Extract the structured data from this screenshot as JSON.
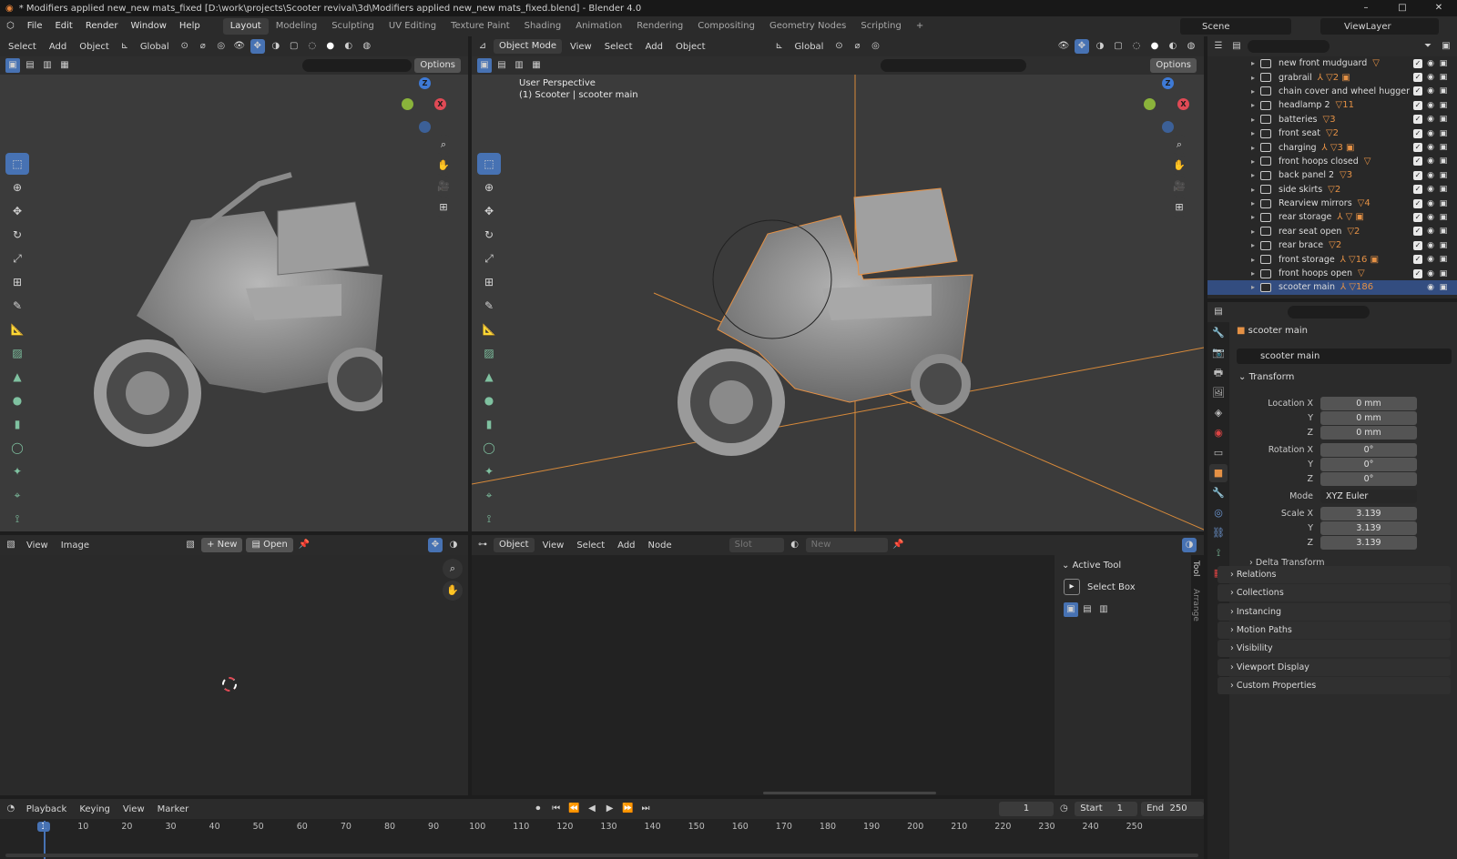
{
  "window": {
    "title": "* Modifiers applied new_new mats_fixed [D:\\work\\projects\\Scooter revival\\3d\\Modifiers applied new_new mats_fixed.blend] - Blender 4.0",
    "min": "–",
    "max": "□",
    "close": "✕"
  },
  "menu": [
    "File",
    "Edit",
    "Render",
    "Window",
    "Help"
  ],
  "workspaces": [
    "Layout",
    "Modeling",
    "Sculpting",
    "UV Editing",
    "Texture Paint",
    "Shading",
    "Animation",
    "Rendering",
    "Compositing",
    "Geometry Nodes",
    "Scripting",
    "+"
  ],
  "scene": {
    "label": "Scene",
    "viewlayer": "ViewLayer"
  },
  "vp_left": {
    "menus": [
      "Select",
      "Add",
      "Object"
    ],
    "orientation": "Global",
    "options": "Options"
  },
  "vp_right": {
    "mode": "Object Mode",
    "menus": [
      "View",
      "Select",
      "Add",
      "Object"
    ],
    "orientation": "Global",
    "options": "Options",
    "overlay_title": "User Perspective",
    "overlay_sub": "(1) Scooter | scooter main"
  },
  "image_editor": {
    "menus": [
      "View",
      "Image"
    ],
    "new": "New",
    "open": "Open"
  },
  "node_editor": {
    "type": "Object",
    "menus": [
      "View",
      "Select",
      "Add",
      "Node"
    ],
    "slot": "Slot",
    "new": "New",
    "side_tabs": [
      "Tool",
      "Arrange"
    ],
    "active_tool_title": "Active Tool",
    "active_tool": "Select Box"
  },
  "outliner": {
    "items": [
      {
        "name": "new front mudguard",
        "icons": "▽"
      },
      {
        "name": "grabrail",
        "icons": "⅄ ▽2 ▣"
      },
      {
        "name": "chain cover and wheel hugger",
        "icons": ""
      },
      {
        "name": "headlamp 2",
        "icons": "▽11"
      },
      {
        "name": "batteries",
        "icons": "▽3"
      },
      {
        "name": "front seat",
        "icons": "▽2"
      },
      {
        "name": "charging",
        "icons": "⅄ ▽3 ▣"
      },
      {
        "name": "front hoops closed",
        "icons": "▽"
      },
      {
        "name": "back panel 2",
        "icons": "▽3"
      },
      {
        "name": "side skirts",
        "icons": "▽2"
      },
      {
        "name": "Rearview mirrors",
        "icons": "▽4"
      },
      {
        "name": "rear storage",
        "icons": "⅄ ▽ ▣"
      },
      {
        "name": "rear seat open",
        "icons": "▽2"
      },
      {
        "name": "rear brace",
        "icons": "▽2"
      },
      {
        "name": "front storage",
        "icons": "⅄ ▽16 ▣"
      },
      {
        "name": "front hoops open",
        "icons": "▽"
      },
      {
        "name": "scooter main",
        "icons": "⅄ ▽186",
        "selected": true
      }
    ]
  },
  "properties": {
    "object_name": "scooter main",
    "datablock": "scooter main",
    "transform_label": "Transform",
    "location_label": "Location X",
    "loc": [
      "0 mm",
      "0 mm",
      "0 mm"
    ],
    "rotation_label": "Rotation X",
    "rot": [
      "0°",
      "0°",
      "0°"
    ],
    "y_label": "Y",
    "z_label": "Z",
    "mode_label": "Mode",
    "mode": "XYZ Euler",
    "scale_label": "Scale X",
    "scale": [
      "3.139",
      "3.139",
      "3.139"
    ],
    "delta": "Delta Transform",
    "panels": [
      "Relations",
      "Collections",
      "Instancing",
      "Motion Paths",
      "Visibility",
      "Viewport Display",
      "Custom Properties"
    ]
  },
  "timeline": {
    "menus": [
      "Playback",
      "Keying",
      "View",
      "Marker"
    ],
    "current": "1",
    "start_label": "Start",
    "start": "1",
    "end_label": "End",
    "end": "250",
    "ticks": [
      "1",
      "10",
      "20",
      "30",
      "40",
      "50",
      "60",
      "70",
      "80",
      "90",
      "100",
      "110",
      "120",
      "130",
      "140",
      "150",
      "160",
      "170",
      "180",
      "190",
      "200",
      "210",
      "220",
      "230",
      "240",
      "250"
    ]
  },
  "colors": {
    "accent": "#4772b3",
    "selection": "#334d80",
    "orange": "#e59145",
    "x_axis": "#e04a55",
    "y_axis": "#8ab33b",
    "z_axis": "#3e7ad6"
  }
}
